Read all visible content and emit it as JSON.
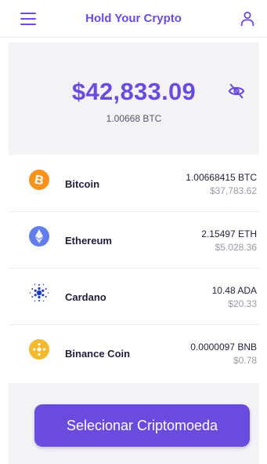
{
  "header": {
    "title": "Hold Your Crypto",
    "menu_icon": "hamburger-menu-icon",
    "profile_icon": "user-icon"
  },
  "balance": {
    "value": "$42,833.09",
    "btc": "1.00668 BTC",
    "visibility_icon": "eye-off-icon"
  },
  "coins": [
    {
      "name": "Bitcoin",
      "amount": "1.00668415 BTC",
      "fiat": "$37,783.62",
      "icon": "bitcoin-icon",
      "color": "#f7931a"
    },
    {
      "name": "Ethereum",
      "amount": "2.15497 ETH",
      "fiat": "$5.028.36",
      "icon": "ethereum-icon",
      "color": "#627eea"
    },
    {
      "name": "Cardano",
      "amount": "10.48 ADA",
      "fiat": "$20.33",
      "icon": "cardano-icon",
      "color": "#1a3bbd"
    },
    {
      "name": "Binance Coin",
      "amount": "0.0000097 BNB",
      "fiat": "$0.78",
      "icon": "binance-coin-icon",
      "color": "#f3ba2f"
    }
  ],
  "footer": {
    "select_label": "Selecionar Criptomoeda"
  },
  "colors": {
    "accent": "#6a4be0",
    "panel": "#f3f3f6"
  }
}
